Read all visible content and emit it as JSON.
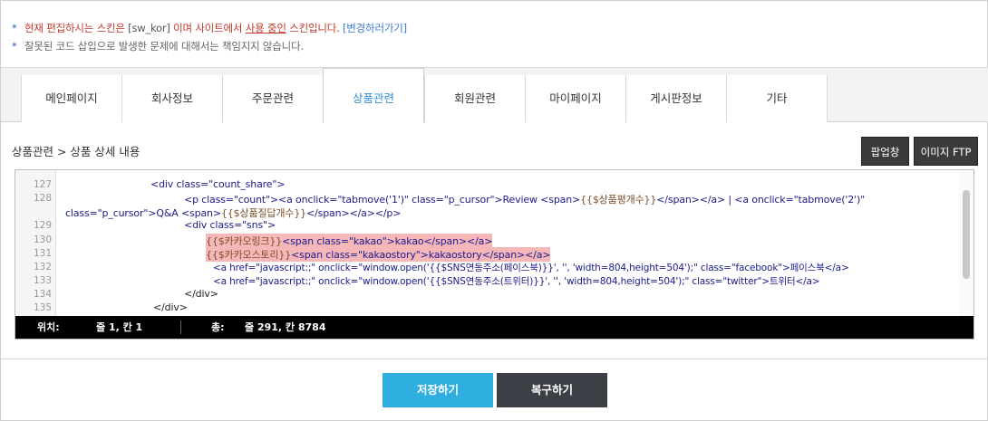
{
  "notices": {
    "line1_a": "현재 편집하시는 스킨은 ",
    "line1_skin": "[sw_kor]",
    "line1_b": " 이며 사이트에서 ",
    "line1_inuse": "사용 중인",
    "line1_c": " 스킨입니다. ",
    "line1_link": "[변경하러가기]",
    "line2": "잘못된 코드 삽입으로 발생한 문제에 대해서는 책임지지 않습니다."
  },
  "tabs": [
    "메인페이지",
    "회사정보",
    "주문관련",
    "상품관련",
    "회원관련",
    "마이페이지",
    "게시판정보",
    "기타"
  ],
  "active_tab": "상품관련",
  "breadcrumb": "상품관련 > 상품 상세 내용",
  "buttons": {
    "popup": "팝업창",
    "image_ftp": "이미지 FTP",
    "save": "저장하기",
    "restore": "복구하기"
  },
  "editor": {
    "line_numbers": [
      "127",
      "128",
      "",
      "129",
      "130",
      "131",
      "132",
      "133",
      "134",
      "135"
    ],
    "status": {
      "position_label": "위치:",
      "position_value": "줄 1, 칸 1",
      "total_label": "총:",
      "total_value": "줄 291, 칸 8784"
    },
    "code": {
      "l127_a": "<div class=",
      "l127_b": "\"count_share\"",
      "l127_c": ">",
      "l128_a": "<p class=",
      "l128_b": "\"count\"",
      "l128_c": "><a onclick=",
      "l128_d": "\"tabmove('1')\"",
      "l128_e": " class=",
      "l128_f": "\"p_cursor\"",
      "l128_g": ">Review <span>",
      "l128_h": "{{$상품평개수}}",
      "l128_i": "</span></a>  |  <a onclick=",
      "l128_j": "\"tabmove('2')\"",
      "l128w_a": "class=",
      "l128w_b": "\"p_cursor\"",
      "l128w_c": ">Q&A <span>",
      "l128w_d": "{{$상품질답개수}}",
      "l128w_e": "</span></a></p>",
      "l129_a": "<div class=",
      "l129_b": "\"sns\"",
      "l129_c": ">",
      "l130_a": "{{$카카오링크}}",
      "l130_b": "<span class=",
      "l130_c": "\"kakao\"",
      "l130_d": ">kakao</span></a>",
      "l131_a": "{{$카카오스토리}}",
      "l131_b": "<span class=",
      "l131_c": "\"kakaostory\"",
      "l131_d": ">kakaostory</span></a>",
      "l132_a": "<a href=",
      "l132_b": "\"javascript:;\"",
      "l132_c": " onclick=",
      "l132_d": "\"window.open('{{$SNS연동주소(페이스북)}}', '', 'width=804,height=504');\"",
      "l132_e": " class=",
      "l132_f": "\"facebook\"",
      "l132_g": ">페이스북</a>",
      "l133_a": "<a href=",
      "l133_b": "\"javascript:;\"",
      "l133_c": " onclick=",
      "l133_d": "\"window.open('{{$SNS연동주소(트위터)}}', '', 'width=804,height=504');\"",
      "l133_e": " class=",
      "l133_f": "\"twitter\"",
      "l133_g": ">트위터</a>",
      "l134": "</div>",
      "l135": "</div>"
    }
  }
}
